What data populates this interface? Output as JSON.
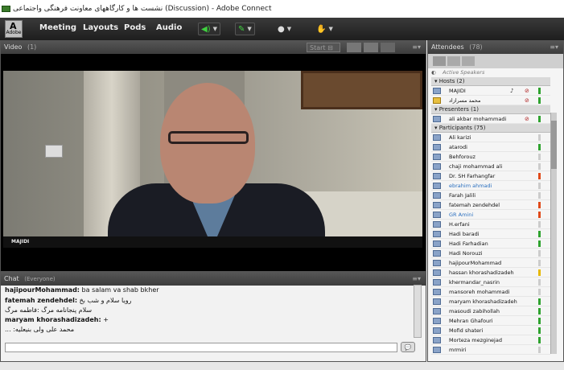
{
  "window": {
    "title": "نشست ها و کارگاههای معاونت فرهنگی واجتماعی (Discussion) - Adobe Connect",
    "logo_text": "Adobe"
  },
  "menu": {
    "items": [
      "Meeting",
      "Layouts",
      "Pods",
      "Audio"
    ]
  },
  "video_pod": {
    "title": "Video",
    "count": "(1)",
    "start_label": "Start",
    "speaker_label": "MAJIDI"
  },
  "chat_pod": {
    "title": "Chat",
    "scope": "(Everyone)",
    "messages": [
      {
        "author": "hajipourMohammad:",
        "text": " ba salam va shab bkher"
      },
      {
        "author": "fatemah zendehdel:",
        "text": " رویا سلام و شب بخ"
      },
      {
        "author": "",
        "text": "سلام پنجانامه مرگ :فاطمه مرگ"
      },
      {
        "author": "maryam khorashadizadeh:",
        "text": " +"
      },
      {
        "author": "",
        "text": "... :محمد علی ولی بنیعلیه"
      }
    ]
  },
  "attendees_pod": {
    "title": "Attendees",
    "count": "(78)",
    "active_speakers": "Active Speakers",
    "hosts_label": "Hosts (2)",
    "presenters_label": "Presenters (1)",
    "participants_label": "Participants (75)",
    "hosts": [
      {
        "name": "MAJIDI"
      },
      {
        "name": "محمد مسرازاد"
      }
    ],
    "presenters": [
      {
        "name": "ali akbar mohammadi"
      }
    ],
    "participants": [
      {
        "name": "Ali karizi",
        "status": "#cccccc"
      },
      {
        "name": "atarodi",
        "status": "#2fa32f"
      },
      {
        "name": "Behforouz",
        "status": "#cccccc"
      },
      {
        "name": "chaji mohammad ali",
        "status": "#cccccc"
      },
      {
        "name": "Dr. SH Farhangfar",
        "status": "#e04a1a"
      },
      {
        "name": "ebrahim ahmadi",
        "status": "#cccccc",
        "color": "#2a6fbf"
      },
      {
        "name": "Farah Jalili",
        "status": "#cccccc"
      },
      {
        "name": "fatemah zendehdel",
        "status": "#e04a1a"
      },
      {
        "name": "GR Amini",
        "status": "#e04a1a",
        "color": "#2a6fbf"
      },
      {
        "name": "H.erfani",
        "status": "#cccccc"
      },
      {
        "name": "Hadi baradi",
        "status": "#2fa32f"
      },
      {
        "name": "Hadi Farhadian",
        "status": "#2fa32f"
      },
      {
        "name": "Hadi Norouzi",
        "status": "#cccccc"
      },
      {
        "name": "hajipourMohammad",
        "status": "#cccccc"
      },
      {
        "name": "hassan khorashadizadeh",
        "status": "#e6b800"
      },
      {
        "name": "khermandar_nasrin",
        "status": "#cccccc"
      },
      {
        "name": "mansoreh mohammadi",
        "status": "#cccccc"
      },
      {
        "name": "maryam khorashadizadeh",
        "status": "#2fa32f"
      },
      {
        "name": "masoudi zabihollah",
        "status": "#2fa32f"
      },
      {
        "name": "Mehran Ghafouri",
        "status": "#2fa32f"
      },
      {
        "name": "Mofid shateri",
        "status": "#2fa32f"
      },
      {
        "name": "Morteza mezginejad",
        "status": "#2fa32f"
      },
      {
        "name": "mrmiri",
        "status": "#cccccc"
      }
    ]
  }
}
